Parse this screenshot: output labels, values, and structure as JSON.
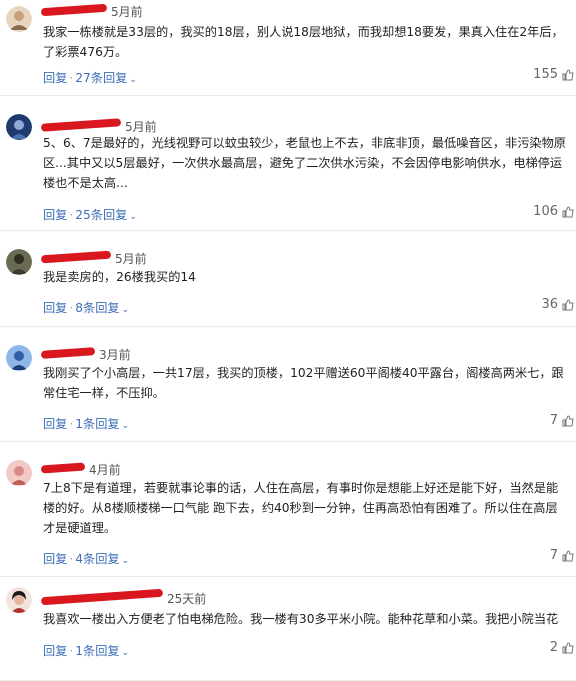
{
  "actions": {
    "reply": "回复",
    "sep": "·"
  },
  "comments": [
    {
      "username": "用户名已涂抹",
      "time": "5月前",
      "text": "我家一栋楼就是33层的，我买的18层，别人说18层地狱，而我却想18要发，果真入住在2年后，\n了彩票476万。",
      "replies": "27条回复",
      "likes": "155",
      "avatar_color": "#c9a07a"
    },
    {
      "username": "用户名已涂抹",
      "time": "5月前",
      "text": "5、6、7是最好的，光线视野可以蚊虫较少，老鼠也上不去，非底非顶，最低噪音区，非污染物原\n区...其中又以5层最好，一次供水最高层，避免了二次供水污染，不会因停电影响供水，电梯停运\n楼也不是太高...",
      "replies": "25条回复",
      "likes": "106",
      "avatar_color": "#2a4a8a"
    },
    {
      "username": "用户名已涂抹",
      "time": "5月前",
      "text": "我是卖房的，26楼我买的14",
      "replies": "8条回复",
      "likes": "36",
      "avatar_color": "#4a4a3a"
    },
    {
      "username": "用户名已涂抹",
      "time": "3月前",
      "text": "我刚买了个小高层，一共17层，我买的顶楼，102平赠送60平阁楼40平露台，阁楼高两米七，跟\n常住宅一样，不压抑。",
      "replies": "1条回复",
      "likes": "7",
      "avatar_color": "#3a6ab0"
    },
    {
      "username": "用户名已涂抹",
      "time": "4月前",
      "text": "7上8下是有道理，若要就事论事的话，人住在高层，有事时你是想能上好还是能下好，当然是能\n楼的好。从8楼顺楼梯一口气能 跑下去，约40秒到一分钟，住再高恐怕有困难了。所以住在高层\n才是硬道理。",
      "replies": "4条回复",
      "likes": "7",
      "avatar_color": "#d98a8a"
    },
    {
      "username": "用户名已涂抹",
      "time": "25天前",
      "text": "我喜欢一楼出入方便老了怕电梯危险。我一楼有30多平米小院。能种花草和小菜。我把小院当花",
      "replies": "1条回复",
      "likes": "2",
      "avatar_color": "#b03030"
    }
  ]
}
